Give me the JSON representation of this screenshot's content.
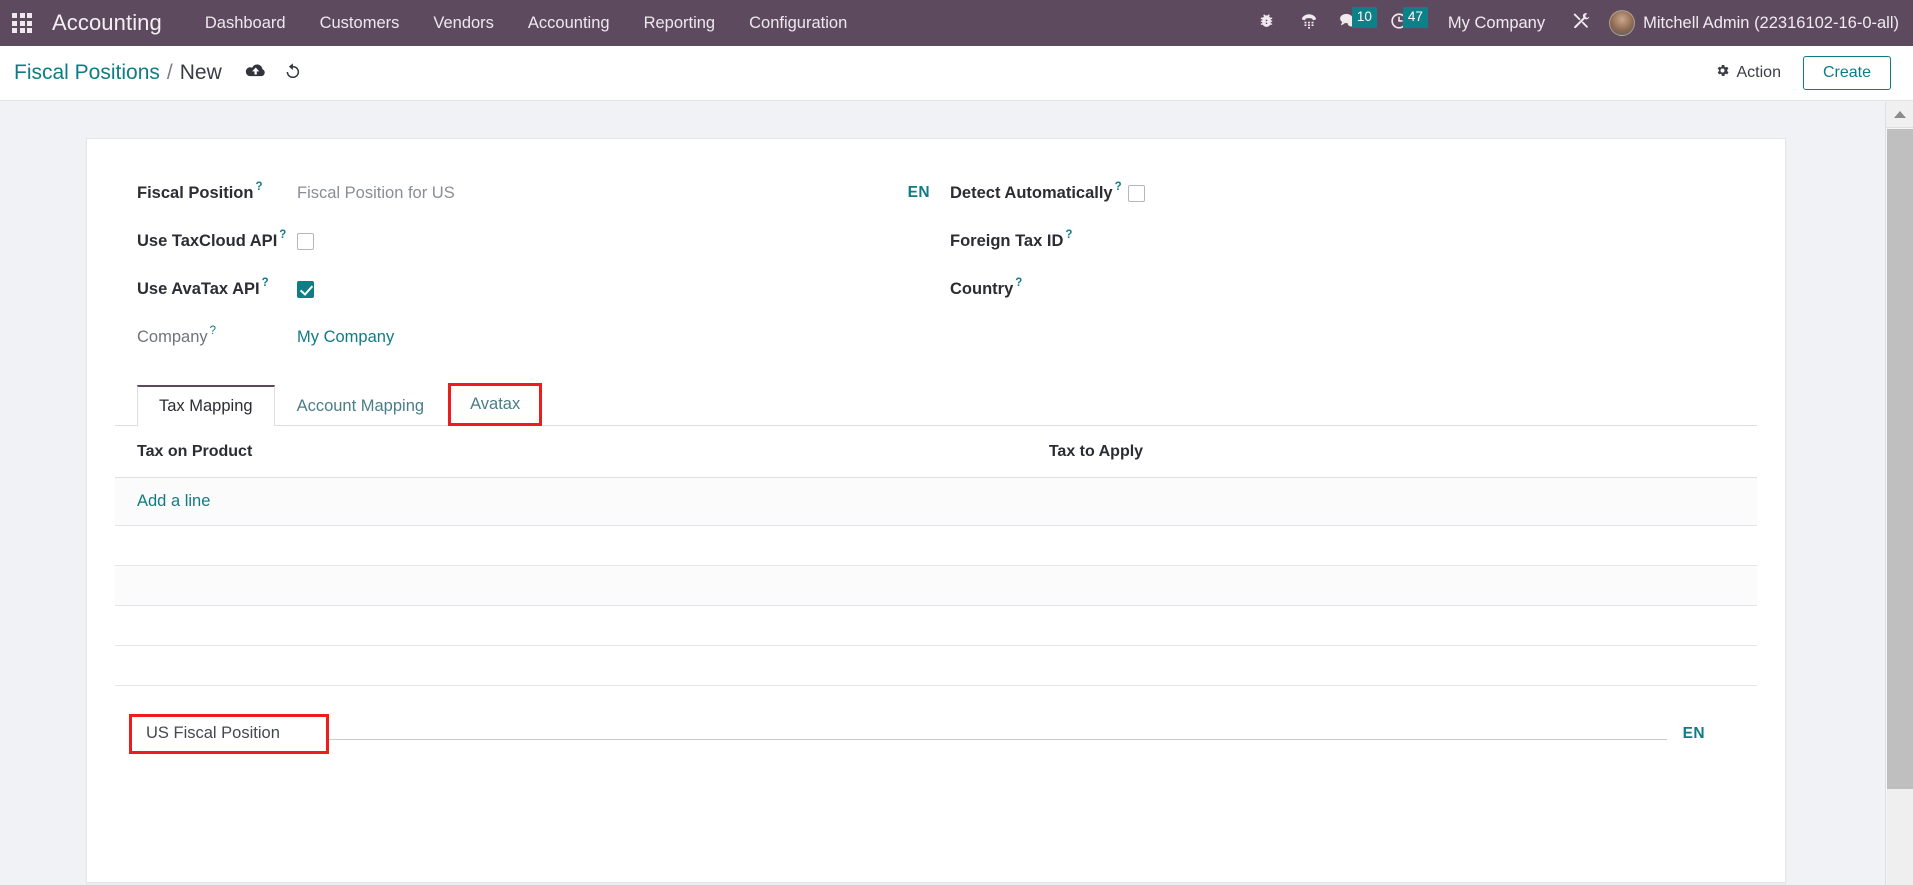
{
  "navbar": {
    "apps_icon": "grid-apps-icon",
    "brand": "Accounting",
    "menu": [
      {
        "label": "Dashboard"
      },
      {
        "label": "Customers"
      },
      {
        "label": "Vendors"
      },
      {
        "label": "Accounting"
      },
      {
        "label": "Reporting"
      },
      {
        "label": "Configuration"
      }
    ],
    "systray": {
      "debug_icon": "bug-icon",
      "voip_icon": "phone-dialpad-icon",
      "messages_icon": "chat-bubble-icon",
      "messages_count": "10",
      "activities_icon": "clock-icon",
      "activities_count": "47",
      "company": "My Company",
      "tools_icon": "wrench-screwdriver-icon",
      "avatar": "user-avatar",
      "user": "Mitchell Admin (22316102-16-0-all)"
    }
  },
  "control_panel": {
    "breadcrumb_root": "Fiscal Positions",
    "breadcrumb_separator": "/",
    "breadcrumb_current": "New",
    "save_icon": "cloud-upload-icon",
    "discard_icon": "undo-icon",
    "action_icon": "gear-icon",
    "action_label": "Action",
    "create_label": "Create"
  },
  "form": {
    "left": [
      {
        "label": "Fiscal Position",
        "tip": "?",
        "type": "text",
        "value": "",
        "placeholder": "Fiscal Position for US",
        "lang": "EN"
      },
      {
        "label": "Use TaxCloud API",
        "tip": "?",
        "type": "checkbox",
        "checked": false
      },
      {
        "label": "Use AvaTax API",
        "tip": "?",
        "type": "checkbox",
        "checked": true
      },
      {
        "label": "Company",
        "tip": "?",
        "type": "link",
        "value": "My Company",
        "muted_label": true
      }
    ],
    "right": [
      {
        "label": "Detect Automatically",
        "tip": "?",
        "type": "checkbox",
        "checked": false
      },
      {
        "label": "Foreign Tax ID",
        "tip": "?",
        "type": "text",
        "value": ""
      },
      {
        "label": "Country",
        "tip": "?",
        "type": "text",
        "value": ""
      }
    ]
  },
  "notebook": {
    "tabs": [
      {
        "label": "Tax Mapping",
        "active": true,
        "annotated": false
      },
      {
        "label": "Account Mapping",
        "active": false,
        "annotated": false
      },
      {
        "label": "Avatax",
        "active": false,
        "annotated": true
      }
    ],
    "table": {
      "columns": [
        "Tax on Product",
        "Tax to Apply"
      ],
      "rows": [],
      "add_line_label": "Add a line",
      "empty_row_count": 4
    }
  },
  "bottom_field": {
    "value": "US Fiscal Position",
    "lang": "EN",
    "annotated": true
  },
  "colors": {
    "navbar_bg": "#5d4a5e",
    "accent_teal": "#0f7c84",
    "badge_teal": "#0e8088",
    "annotation_red": "#ee1c1c",
    "page_bg": "#f0f2f6",
    "sheet_bg": "#ffffff"
  },
  "scrollbar": {
    "up_arrow_icon": "triangle-up-icon"
  }
}
